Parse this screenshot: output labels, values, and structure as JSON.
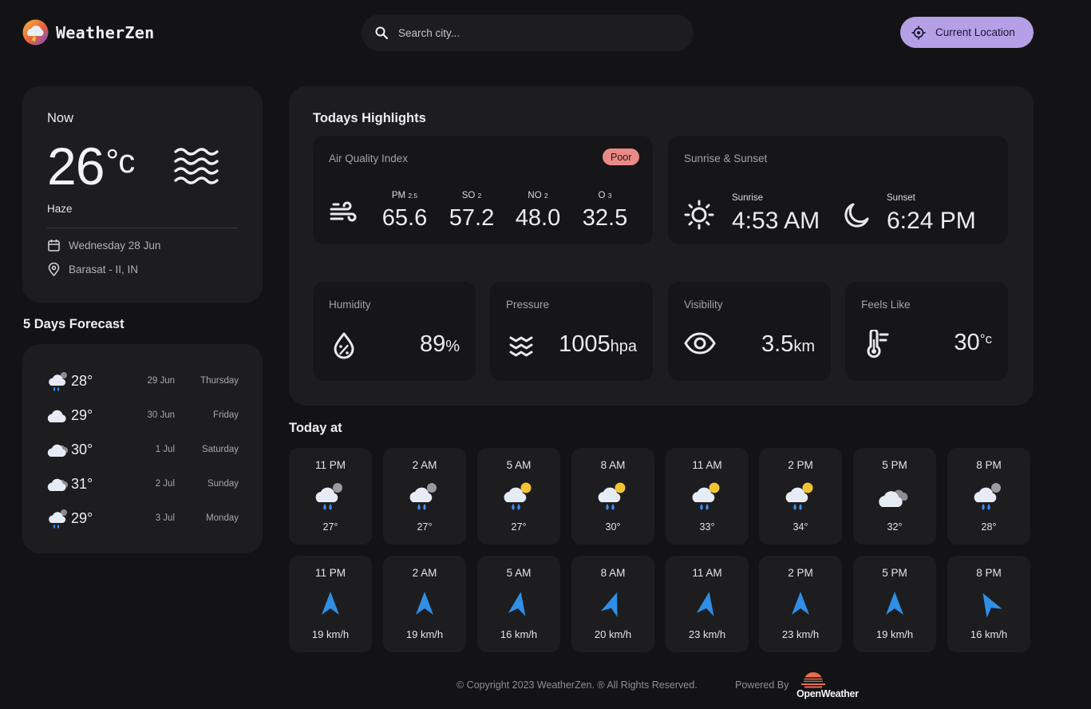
{
  "app": {
    "name": "WeatherZen"
  },
  "search": {
    "placeholder": "Search city..."
  },
  "location_button": {
    "label": "Current Location"
  },
  "now": {
    "label": "Now",
    "temp": "26",
    "unit": "°c",
    "description": "Haze",
    "date": "Wednesday 28 Jun",
    "location": "Barasat - II, IN"
  },
  "forecast": {
    "title": "5 Days Forecast",
    "days": [
      {
        "icon": "cloud-rain-sun-icon",
        "temp": "28°",
        "date": "29 Jun",
        "day": "Thursday"
      },
      {
        "icon": "cloud-icon",
        "temp": "29°",
        "date": "30 Jun",
        "day": "Friday"
      },
      {
        "icon": "cloud-overcast-icon",
        "temp": "30°",
        "date": "1 Jul",
        "day": "Saturday"
      },
      {
        "icon": "cloud-overcast-icon",
        "temp": "31°",
        "date": "2 Jul",
        "day": "Sunday"
      },
      {
        "icon": "cloud-rain-sun-icon",
        "temp": "29°",
        "date": "3 Jul",
        "day": "Monday"
      }
    ]
  },
  "highlights": {
    "title": "Todays Highlights",
    "aqi": {
      "label": "Air Quality Index",
      "badge": "Poor",
      "items": [
        {
          "name": "PM",
          "sub": "2.5",
          "value": "65.6"
        },
        {
          "name": "SO",
          "sub": "2",
          "value": "57.2"
        },
        {
          "name": "NO",
          "sub": "2",
          "value": "48.0"
        },
        {
          "name": "O",
          "sub": "3",
          "value": "32.5"
        }
      ]
    },
    "sun": {
      "label": "Sunrise & Sunset",
      "sunrise_label": "Sunrise",
      "sunrise": "4:53 AM",
      "sunset_label": "Sunset",
      "sunset": "6:24 PM"
    },
    "humidity": {
      "label": "Humidity",
      "value": "89",
      "unit": "%"
    },
    "pressure": {
      "label": "Pressure",
      "value": "1005",
      "unit": "hpa"
    },
    "visibility": {
      "label": "Visibility",
      "value": "3.5",
      "unit": "km"
    },
    "feels_like": {
      "label": "Feels Like",
      "value": "30",
      "unit": "°c"
    }
  },
  "today": {
    "title": "Today at",
    "hours": [
      {
        "time": "11 PM",
        "icon": "cloud-rain-moon-icon",
        "temp": "27°",
        "wind": "19 km/h",
        "wind_deg": 0
      },
      {
        "time": "2 AM",
        "icon": "cloud-rain-moon-icon",
        "temp": "27°",
        "wind": "19 km/h",
        "wind_deg": 0
      },
      {
        "time": "5 AM",
        "icon": "cloud-rain-sun-icon",
        "temp": "27°",
        "wind": "16 km/h",
        "wind_deg": 10
      },
      {
        "time": "8 AM",
        "icon": "cloud-rain-sun-icon",
        "temp": "30°",
        "wind": "20 km/h",
        "wind_deg": 20
      },
      {
        "time": "11 AM",
        "icon": "cloud-rain-sun-icon",
        "temp": "33°",
        "wind": "23 km/h",
        "wind_deg": 10
      },
      {
        "time": "2 PM",
        "icon": "cloud-rain-sun-icon",
        "temp": "34°",
        "wind": "23 km/h",
        "wind_deg": 0
      },
      {
        "time": "5 PM",
        "icon": "cloud-overcast-icon",
        "temp": "32°",
        "wind": "19 km/h",
        "wind_deg": 0
      },
      {
        "time": "8 PM",
        "icon": "cloud-rain-moon-icon",
        "temp": "28°",
        "wind": "16 km/h",
        "wind_deg": -30
      }
    ]
  },
  "footer": {
    "copyright": "© Copyright 2023 WeatherZen. ® All Rights Reserved.",
    "powered": "Powered By",
    "brand": "OpenWeather"
  },
  "colors": {
    "accent": "#b5a0e8",
    "badge": "#e98a86",
    "wind_arrow": "#2f8fe6",
    "background": "#131315",
    "card": "#1d1d20"
  }
}
